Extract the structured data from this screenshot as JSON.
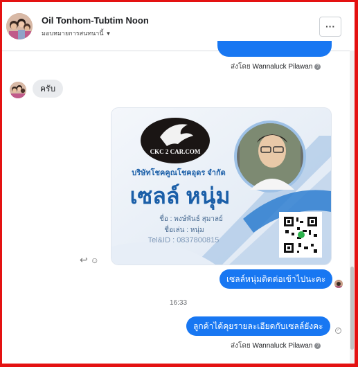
{
  "header": {
    "contact_name": "Oil Tonhom-Tubtim Noon",
    "subtitle": "มอบหมายการสนทนานี้",
    "more_label": "···"
  },
  "messages": {
    "sent_by_prefix": "ส่งโดย",
    "sent_by_name": "Wannaluck Pilawan",
    "incoming_text": "ครับ",
    "outgoing_1": "เซลล์หนุ่มติดต่อเข้าไปนะคะ",
    "timestamp": "16:33",
    "outgoing_2": "ลูกค้าได้คุยรายละเอียดกับเซลล์ยังคะ"
  },
  "card": {
    "logo_text": "CKC 2 CAR.COM",
    "company": "บริษัทโชคคูณโชคอุดร จำกัด",
    "headline": "เซลล์ หนุ่ม",
    "name_line": "ชื่อ : พงษ์พันธ์ สุมาลย์",
    "nickname_line": "ชื่อเล่น : หนุ่ม",
    "tel_line": "Tel&ID : 0837800815"
  },
  "colors": {
    "messenger_blue": "#1877f2",
    "frame_red": "#e41212",
    "card_blue": "#1b5fa8"
  }
}
